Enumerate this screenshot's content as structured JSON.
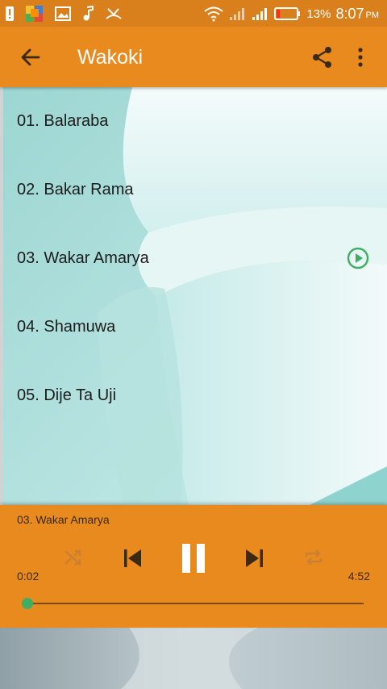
{
  "status_bar": {
    "battery_percent": "13%",
    "time": "8:07",
    "ampm": "PM",
    "icons": [
      "alert-icon",
      "app-grid-icon",
      "gallery-icon",
      "music-note-icon",
      "missed-call-icon",
      "wifi-icon",
      "signal-icon",
      "signal-icon",
      "battery-icon"
    ]
  },
  "app_bar": {
    "title": "Wakoki",
    "icons": [
      "back-arrow-icon",
      "share-icon",
      "more-vert-icon"
    ]
  },
  "tracks": [
    {
      "title": "01. Balaraba"
    },
    {
      "title": "02. Bakar Rama"
    },
    {
      "title": "03. Wakar Amarya",
      "playing": true
    },
    {
      "title": "04. Shamuwa"
    },
    {
      "title": "05. Dije Ta Uji"
    }
  ],
  "player": {
    "now_playing": "03. Wakar Amarya",
    "elapsed": "0:02",
    "total": "4:52",
    "progress_fraction": 0.007,
    "controls": [
      "shuffle-icon",
      "previous-icon",
      "pause-icon",
      "next-icon",
      "repeat-icon"
    ]
  },
  "colors": {
    "status_bar": "#d9801c",
    "primary": "#e88a1e",
    "accent_green": "#3fae62",
    "text_dark": "#1c1c1c"
  }
}
